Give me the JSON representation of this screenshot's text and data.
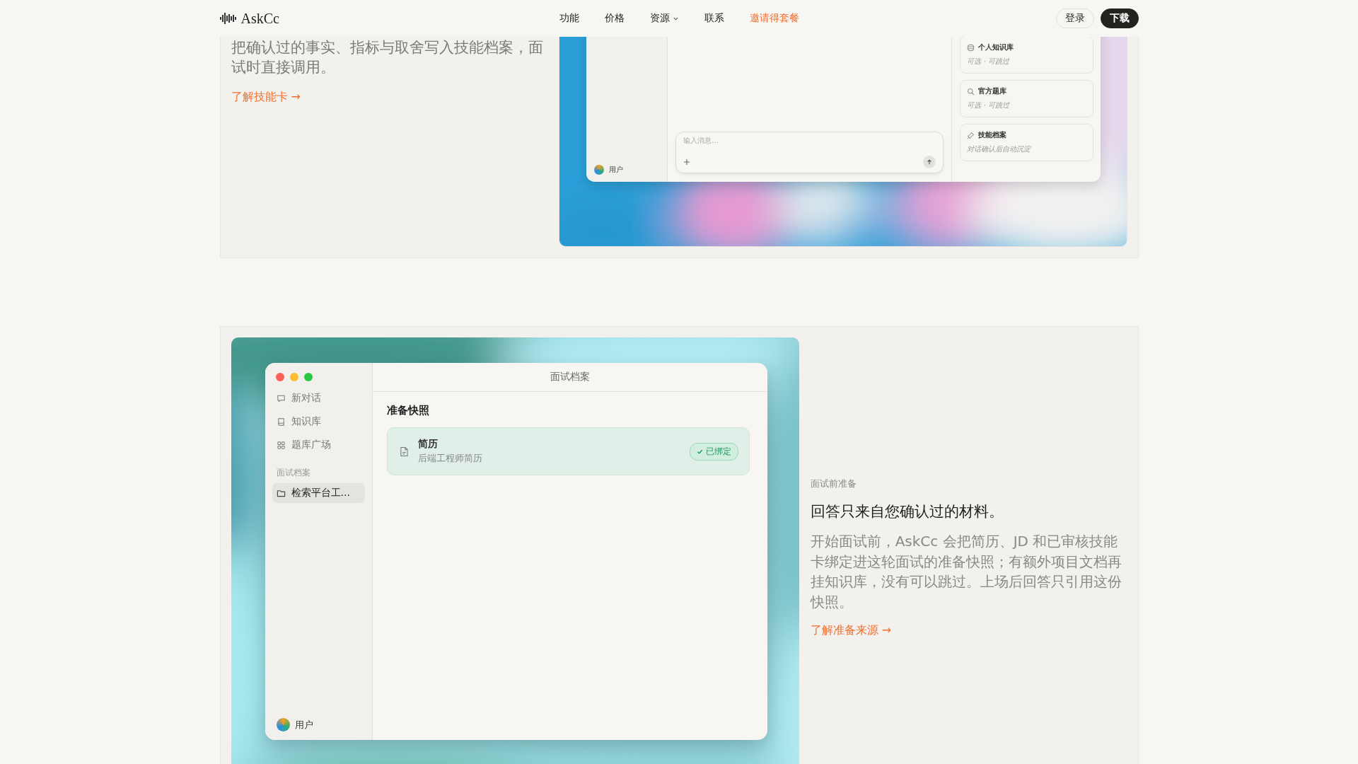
{
  "header": {
    "logo": "AskCc",
    "nav": [
      {
        "label": "功能",
        "kind": "plain"
      },
      {
        "label": "价格",
        "kind": "plain"
      },
      {
        "label": "资源",
        "kind": "dropdown"
      },
      {
        "label": "联系",
        "kind": "plain"
      },
      {
        "label": "邀请得套餐",
        "kind": "highlight"
      }
    ],
    "actions": [
      {
        "label": "登录",
        "kind": "outline"
      },
      {
        "label": "下载",
        "kind": "primary"
      }
    ]
  },
  "feature_skills": {
    "body": "把确认过的事实、指标与取舍写入技能档案，面试时直接调用。",
    "link": "了解技能卡 →",
    "screenshot": {
      "kind": "picture",
      "window": {
        "user": "用户",
        "input_placeholder": "输入消息...",
        "sources": [
          {
            "kind": "database",
            "title": "个人知识库",
            "note": "可选 · 可跳过"
          },
          {
            "kind": "search",
            "title": "官方题库",
            "note": "可选 · 可跳过"
          },
          {
            "kind": "pin",
            "title": "技能档案",
            "note": "对话确认后自动沉淀"
          }
        ]
      }
    }
  },
  "feature_prep": {
    "screenshot": {
      "kind": "picture",
      "window": {
        "title": "面试档案",
        "nav": [
          {
            "kind": "chat",
            "label": "新对话"
          },
          {
            "kind": "book",
            "label": "知识库"
          },
          {
            "kind": "grid",
            "label": "题库广场"
          }
        ],
        "section_label": "面试档案",
        "items": [
          {
            "label": "检索平台工...",
            "selected": true
          }
        ],
        "user": "用户",
        "heading": "准备快照",
        "cards": [
          {
            "title": "简历",
            "subtitle": "后端工程师简历",
            "badge": "已绑定"
          }
        ]
      }
    },
    "eyebrow": "面试前准备",
    "title": "回答只来自您确认过的材料。",
    "body": "开始面试前，AskCc 会把简历、JD 和已审核技能卡绑定进这轮面试的准备快照；有额外项目文档再挂知识库，没有可以跳过。上场后回答只引用这份快照。",
    "link": "了解准备来源 →"
  }
}
